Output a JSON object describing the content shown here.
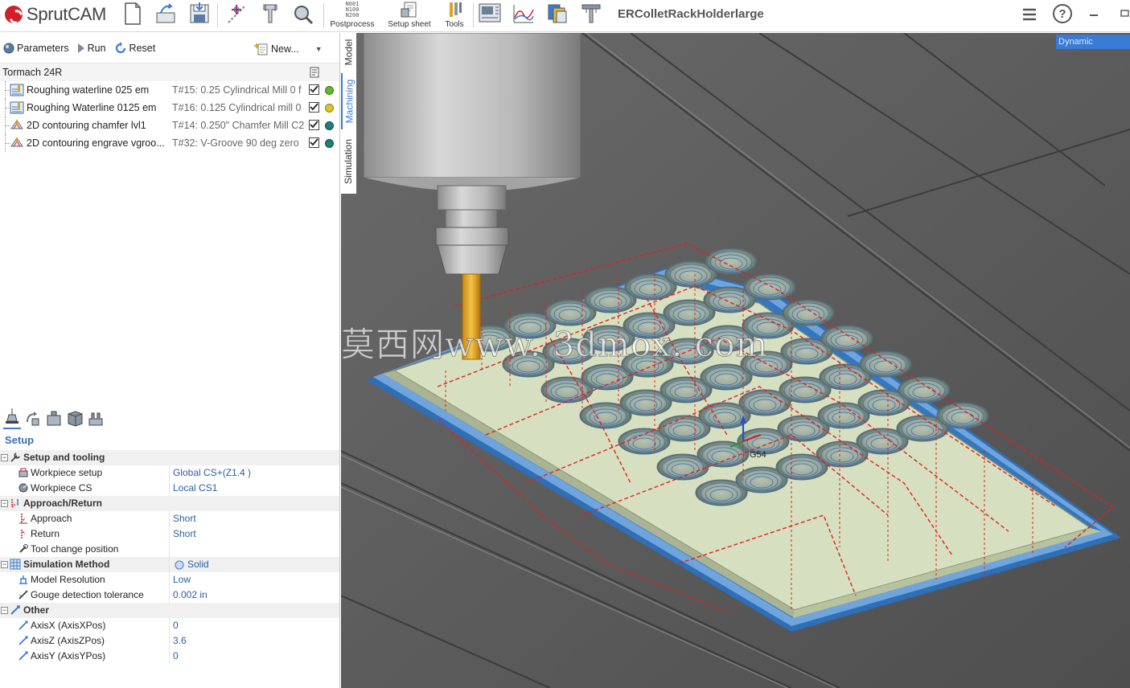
{
  "app": {
    "logo_text": "SprutCAM",
    "document_title": "ERColletRackHolderlarge"
  },
  "toolbar": {
    "postprocess_label": "Postprocess",
    "postprocess_glyph": "N001\nN100\nN200",
    "setup_sheet_label": "Setup sheet",
    "tools_label": "Tools"
  },
  "panel": {
    "parameters_label": "Parameters",
    "run_label": "Run",
    "reset_label": "Reset",
    "new_label": "New..."
  },
  "machine": {
    "name": "Tormach 24R"
  },
  "operations": [
    {
      "name": "Roughing waterline 025 em",
      "tool": "T#15: 0.25 Cylindrical Mill 0 f",
      "status_color": "#5fb832"
    },
    {
      "name": "Roughing Waterline 0125 em",
      "tool": "T#16: 0.125 Cylindrical mill 0",
      "status_color": "#d7c62a"
    },
    {
      "name": "2D contouring chamfer lvl1",
      "tool": "T#14: 0.250\" Chamfer Mill C2",
      "status_color": "#1f7f7a"
    },
    {
      "name": "2D contouring engrave vgroo...",
      "tool": "T#32: V-Groove 90 deg zero",
      "status_color": "#1f7f7a"
    }
  ],
  "vtabs": {
    "model": "Model",
    "machining": "Machining",
    "simulation": "Simulation"
  },
  "setup": {
    "title": "Setup",
    "groups": {
      "setup_tooling": "Setup and tooling",
      "approach_return": "Approach/Return",
      "simulation_method": "Simulation Method",
      "other": "Other"
    },
    "rows": {
      "workpiece_setup": {
        "name": "Workpiece setup",
        "value": "Global CS+(Z1.4 )"
      },
      "workpiece_cs": {
        "name": "Workpiece CS",
        "value": "Local CS1"
      },
      "approach": {
        "name": "Approach",
        "value": "Short"
      },
      "return": {
        "name": "Return",
        "value": "Short"
      },
      "tool_change": {
        "name": "Tool change position",
        "value": ""
      },
      "sim_method_value": "Solid",
      "model_resolution": {
        "name": "Model Resolution",
        "value": "Low"
      },
      "gouge": {
        "name": "Gouge detection tolerance",
        "value": "0.002 in"
      },
      "axis_x": {
        "name": "AxisX (AxisXPos)",
        "value": "0"
      },
      "axis_z": {
        "name": "AxisZ (AxisZPos)",
        "value": "3.6"
      },
      "axis_y": {
        "name": "AxisY (AxisYPos)",
        "value": "0"
      }
    }
  },
  "viewport": {
    "view_mode": "Dynamic",
    "cs_label": "G54",
    "watermark": "莫西网www. 3dmox. com"
  }
}
